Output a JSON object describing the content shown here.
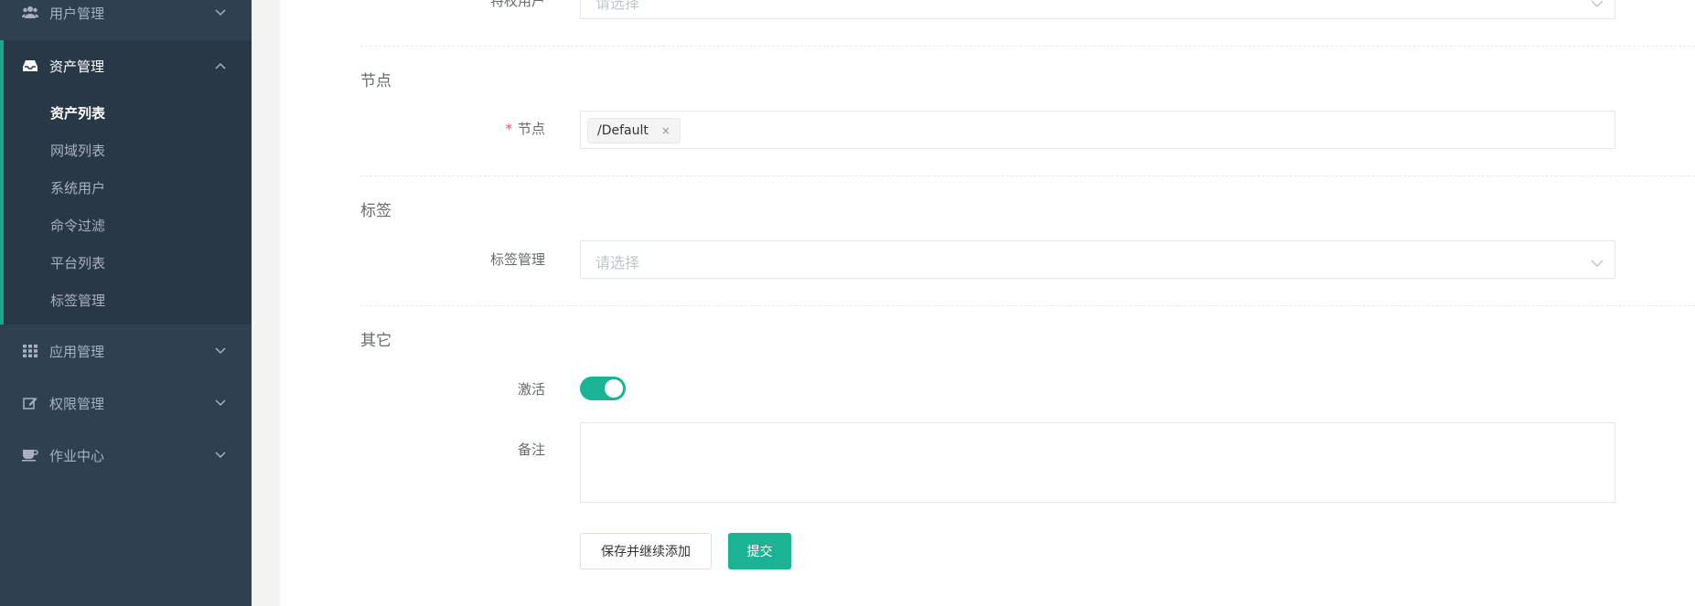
{
  "sidebar": {
    "user_mgmt": {
      "label": "用户管理",
      "icon": "users-icon"
    },
    "asset_mgmt": {
      "label": "资产管理",
      "icon": "inbox-icon",
      "children": [
        "资产列表",
        "网域列表",
        "系统用户",
        "命令过滤",
        "平台列表",
        "标签管理"
      ],
      "current": "资产列表"
    },
    "app_mgmt": {
      "label": "应用管理",
      "icon": "grid-icon"
    },
    "perm_mgmt": {
      "label": "权限管理",
      "icon": "edit-icon"
    },
    "ops_center": {
      "label": "作业中心",
      "icon": "coffee-icon"
    }
  },
  "form": {
    "top_field": {
      "label": "特权用户",
      "placeholder": "请选择"
    },
    "node_section": {
      "title": "节点",
      "label": "节点",
      "required_mark": "*",
      "tags": [
        "/Default"
      ],
      "tag_remove": "×"
    },
    "label_section": {
      "title": "标签",
      "label": "标签管理",
      "placeholder": "请选择"
    },
    "other_section": {
      "title": "其它",
      "active_label": "激活",
      "active_value": true,
      "comment_label": "备注",
      "comment_value": ""
    },
    "buttons": {
      "save_continue": "保存并继续添加",
      "submit": "提交"
    }
  },
  "colors": {
    "sidebar_bg": "#2f4050",
    "sidebar_active_bg": "#293846",
    "accent": "#19aa8d",
    "primary": "#1ab394",
    "required": "#ed5565"
  }
}
